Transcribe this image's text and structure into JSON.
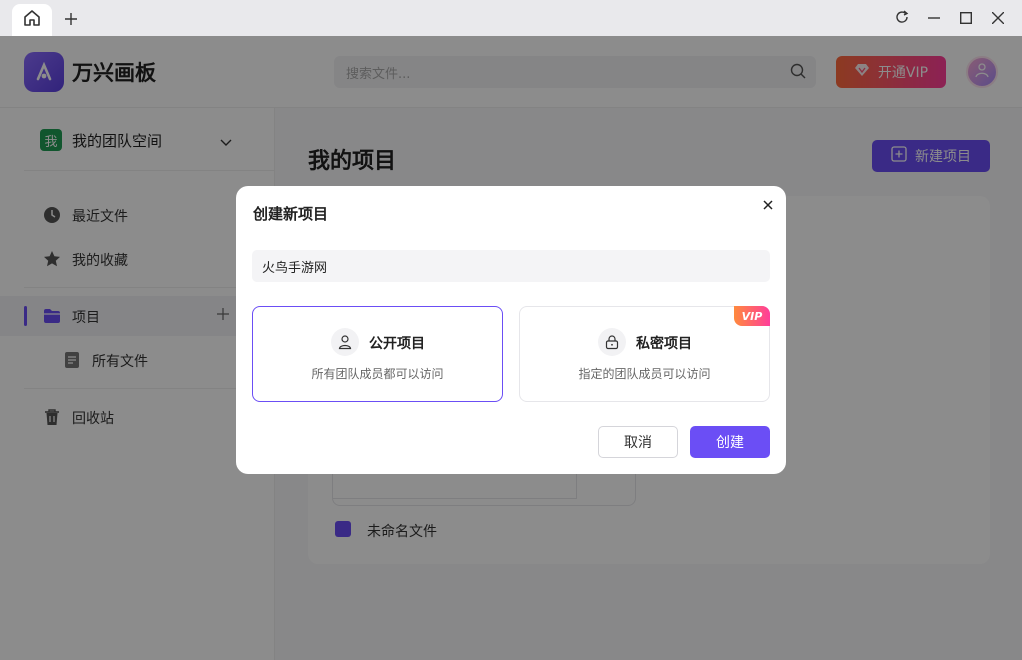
{
  "app": {
    "name": "万兴画板"
  },
  "search": {
    "placeholder": "搜索文件..."
  },
  "header": {
    "vip_label": "开通VIP"
  },
  "sidebar": {
    "team_badge": "我",
    "team_name": "我的团队空间",
    "items": [
      {
        "label": "最近文件"
      },
      {
        "label": "我的收藏"
      },
      {
        "label": "项目"
      },
      {
        "label": "所有文件"
      },
      {
        "label": "回收站"
      }
    ]
  },
  "main": {
    "title": "我的项目",
    "new_project_label": "新建项目",
    "file_name": "未命名文件"
  },
  "dialog": {
    "title": "创建新项目",
    "name_value": "火鸟手游网",
    "options": [
      {
        "title": "公开项目",
        "desc": "所有团队成员都可以访问"
      },
      {
        "title": "私密项目",
        "desc": "指定的团队成员可以访问",
        "badge": "VIP"
      }
    ],
    "cancel_label": "取消",
    "create_label": "创建"
  },
  "colors": {
    "accent": "#6b4ef5",
    "vip_gradient_start": "#ff6b3d",
    "vip_gradient_end": "#ff3d9a"
  }
}
